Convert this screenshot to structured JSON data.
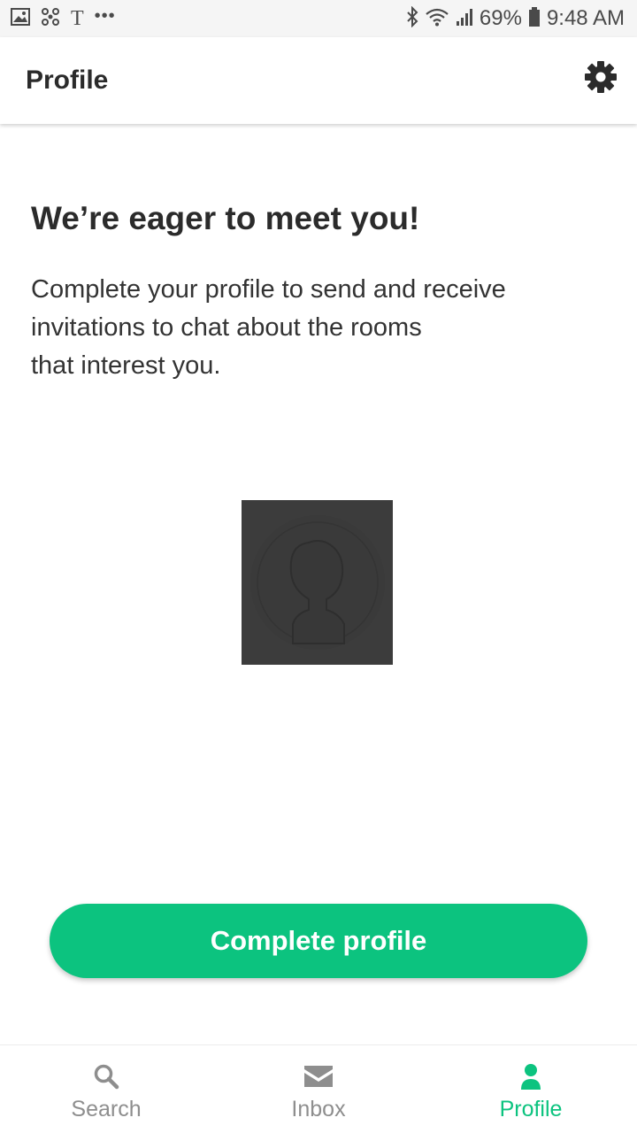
{
  "status_bar": {
    "left_icons": [
      "image-icon",
      "bluetooth-share-icon",
      "t-icon",
      "more-dots-icon"
    ],
    "t_glyph": "T",
    "dots": "•••",
    "battery_percent": "69%",
    "time": "9:48 AM",
    "right_icons": [
      "bluetooth-icon",
      "wifi-icon",
      "signal-icon",
      "battery-icon"
    ]
  },
  "app_bar": {
    "title": "Profile",
    "settings_icon": "gear-icon"
  },
  "content": {
    "heading": "We’re eager to meet you!",
    "body_lines": [
      "Complete your profile to send and receive",
      "invitations to chat about the rooms",
      "that interest you."
    ],
    "avatar_icon": "user-silhouette-icon"
  },
  "cta": {
    "label": "Complete profile"
  },
  "bottom_nav": {
    "items": [
      {
        "label": "Search",
        "icon": "search-icon",
        "active": false
      },
      {
        "label": "Inbox",
        "icon": "envelope-icon",
        "active": false
      },
      {
        "label": "Profile",
        "icon": "person-icon",
        "active": true
      }
    ]
  },
  "colors": {
    "accent": "#0cc37f",
    "inactive": "#8e8e8e",
    "text": "#2b2b2b",
    "avatar_bg": "#3c3c3c"
  }
}
